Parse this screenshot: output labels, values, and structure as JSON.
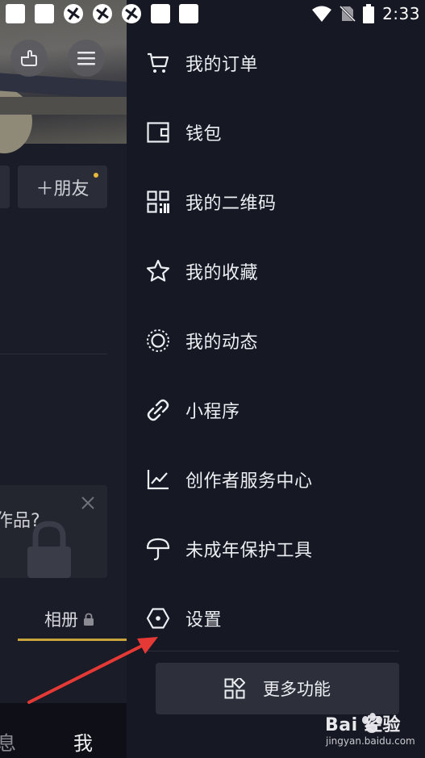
{
  "status_bar": {
    "time": "2:33"
  },
  "profile_bg": {
    "add_friends_label": "＋朋友",
    "card_text": "作品?",
    "album_tab_label": "相册",
    "nav_left_label": "息",
    "nav_me_label": "我"
  },
  "drawer": {
    "items": [
      {
        "label": "我的订单",
        "icon": "cart-icon"
      },
      {
        "label": "钱包",
        "icon": "wallet-icon"
      },
      {
        "label": "我的二维码",
        "icon": "qr-code-icon"
      },
      {
        "label": "我的收藏",
        "icon": "star-icon"
      },
      {
        "label": "我的动态",
        "icon": "dynamic-circle-icon"
      },
      {
        "label": "小程序",
        "icon": "link-icon"
      },
      {
        "label": "创作者服务中心",
        "icon": "chart-line-icon"
      },
      {
        "label": "未成年保护工具",
        "icon": "umbrella-icon"
      },
      {
        "label": "设置",
        "icon": "settings-hexagon-icon"
      }
    ],
    "more_button_label": "更多功能"
  },
  "watermark": {
    "brand": "Bai 经验",
    "url": "jingyan.baidu.com"
  },
  "colors": {
    "background": "#161823",
    "accent_gold": "#c8a43a",
    "annotation_red": "#e53935"
  }
}
